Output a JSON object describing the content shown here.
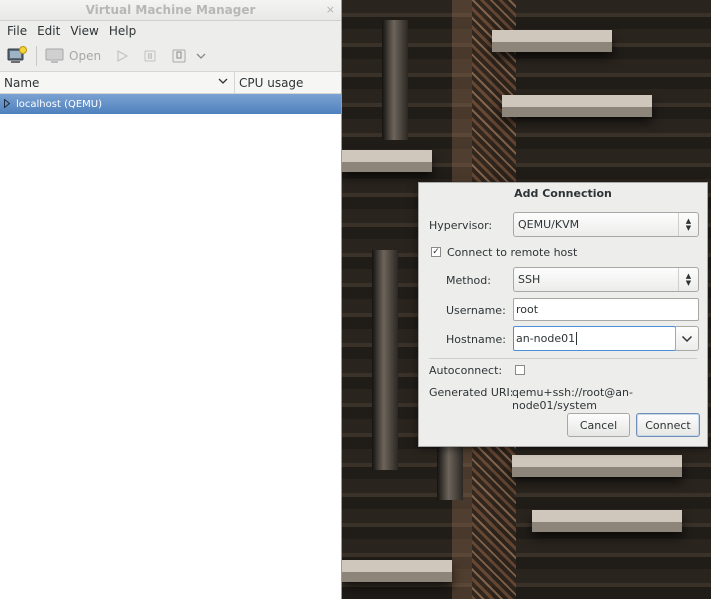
{
  "vmm": {
    "title": "Virtual Machine Manager",
    "close_glyph": "×",
    "menu": [
      "File",
      "Edit",
      "View",
      "Help"
    ],
    "toolbar": {
      "open_label": "Open"
    },
    "columns": {
      "name": "Name",
      "cpu": "CPU usage"
    },
    "rows": [
      {
        "label": "localhost (QEMU)"
      }
    ]
  },
  "dialog": {
    "title": "Add Connection",
    "hypervisor_label": "Hypervisor:",
    "hypervisor_value": "QEMU/KVM",
    "remote_label": "Connect to remote host",
    "remote_checked": true,
    "method_label": "Method:",
    "method_value": "SSH",
    "username_label": "Username:",
    "username_value": "root",
    "hostname_label": "Hostname:",
    "hostname_value": "an-node01",
    "autoconnect_label": "Autoconnect:",
    "autoconnect_checked": false,
    "uri_label": "Generated URI:",
    "uri_value": "qemu+ssh://root@an-node01/system",
    "cancel_label": "Cancel",
    "connect_label": "Connect"
  },
  "colors": {
    "selection": "#4f81bd",
    "focus": "#4a90d9"
  }
}
